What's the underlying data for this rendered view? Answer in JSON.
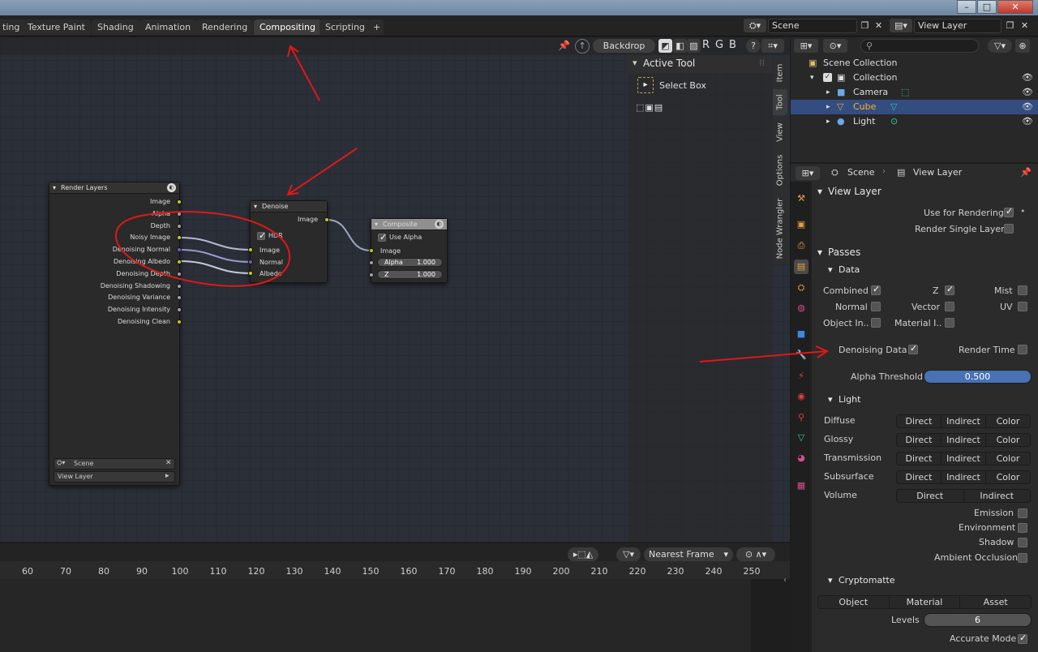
{
  "workspace_tabs": [
    "ting",
    "Texture Paint",
    "Shading",
    "Animation",
    "Rendering",
    "Compositing",
    "Scripting"
  ],
  "active_tab": "Compositing",
  "add_tab": "+",
  "scene_field": "Scene",
  "view_layer_field": "View Layer",
  "node_header": {
    "backdrop": "Backdrop",
    "channels": [
      "R",
      "G",
      "B"
    ]
  },
  "sidebar": {
    "panel_title": "Active Tool",
    "tool_name": "Select Box",
    "tabs": [
      "Item",
      "Tool",
      "View",
      "Options",
      "Node Wrangler"
    ]
  },
  "nodes": {
    "render_layers": {
      "title": "Render Layers",
      "outputs": [
        "Image",
        "Alpha",
        "Depth",
        "Noisy Image",
        "Denoising Normal",
        "Denoising Albedo",
        "Denoising Depth",
        "Denoising Shadowing",
        "Denoising Variance",
        "Denoising Intensity",
        "Denoising Clean"
      ],
      "scene": "Scene",
      "view_layer": "View Layer"
    },
    "denoise": {
      "title": "Denoise",
      "output": "Image",
      "hdr": "HDR",
      "inputs": [
        "Image",
        "Normal",
        "Albedo"
      ]
    },
    "composite": {
      "title": "Composite",
      "use_alpha": "Use Alpha",
      "image": "Image",
      "alpha_label": "Alpha",
      "alpha_value": "1.000",
      "z_label": "Z",
      "z_value": "1.000"
    }
  },
  "timeline": {
    "snap": "Nearest Frame",
    "ticks": [
      "60",
      "70",
      "80",
      "90",
      "100",
      "110",
      "120",
      "130",
      "140",
      "150",
      "160",
      "170",
      "180",
      "190",
      "200",
      "210",
      "220",
      "230",
      "240",
      "250"
    ]
  },
  "outliner": {
    "root": "Scene Collection",
    "items": [
      {
        "name": "Collection",
        "depth": 1
      },
      {
        "name": "Camera",
        "depth": 2
      },
      {
        "name": "Cube",
        "depth": 2
      },
      {
        "name": "Light",
        "depth": 2
      }
    ]
  },
  "properties": {
    "breadcrumb_scene": "Scene",
    "breadcrumb_layer": "View Layer",
    "view_layer_header": "View Layer",
    "use_for_rendering": "Use for Rendering",
    "render_single_layer": "Render Single Layer",
    "passes_header": "Passes",
    "data_header": "Data",
    "data_passes": {
      "combined": "Combined",
      "z": "Z",
      "mist": "Mist",
      "normal": "Normal",
      "vector": "Vector",
      "uv": "UV",
      "object_index": "Object In..",
      "material_index": "Material I..",
      "denoising_data": "Denoising Data",
      "render_time": "Render Time"
    },
    "alpha_threshold_label": "Alpha Threshold",
    "alpha_threshold_value": "0.500",
    "light_header": "Light",
    "light_rows": [
      "Diffuse",
      "Glossy",
      "Transmission",
      "Subsurface",
      "Volume"
    ],
    "light_buttons": [
      "Direct",
      "Indirect",
      "Color"
    ],
    "light_extra": [
      "Emission",
      "Environment",
      "Shadow",
      "Ambient Occlusion"
    ],
    "crypto_header": "Cryptomatte",
    "crypto_buttons": [
      "Object",
      "Material",
      "Asset"
    ],
    "levels_label": "Levels",
    "levels_value": "6",
    "accurate_mode": "Accurate Mode"
  },
  "colors": {
    "accent": "#4772b3",
    "annotation": "#e01818",
    "socket_yellow": "#c7c729"
  }
}
